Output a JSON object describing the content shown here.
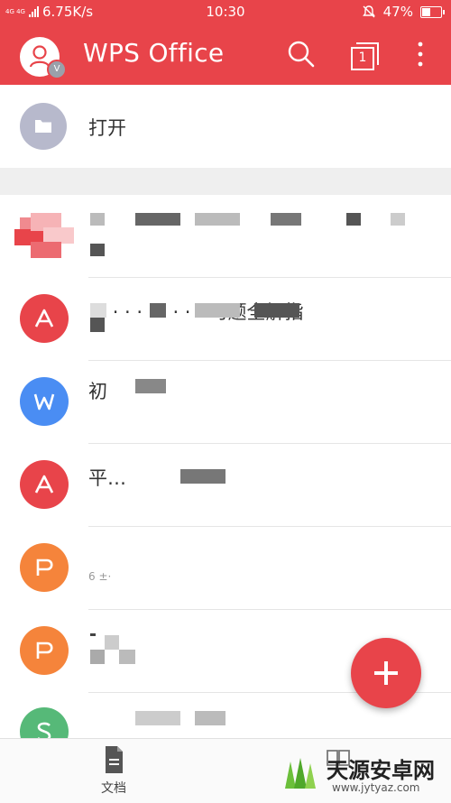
{
  "status_bar": {
    "network_badge": "4G 4G",
    "speed": "6.75K/s",
    "time": "10:30",
    "battery_percent": "47%",
    "battery_level": 0.47
  },
  "app_bar": {
    "title": "WPS Office",
    "avatar_badge": "V",
    "tab_count": "1"
  },
  "open_item": {
    "label": "打开"
  },
  "files": [
    {
      "icon": "pdf",
      "color": "#e8444a",
      "name": "",
      "sub": ""
    },
    {
      "icon": "pdf",
      "color": "#e8444a",
      "name": "·  ·  ·  ·   ·  ·  ·  ·   ·  ·  习题全解指",
      "sub": ""
    },
    {
      "icon": "writer",
      "color": "#4a8df3",
      "name": "初",
      "sub": ""
    },
    {
      "icon": "pdf",
      "color": "#e8444a",
      "name": "平…",
      "sub": ""
    },
    {
      "icon": "presentation",
      "color": "#f5843b",
      "name": "",
      "sub": "6 ±·"
    },
    {
      "icon": "presentation",
      "color": "#f5843b",
      "name": "",
      "sub": ""
    },
    {
      "icon": "spreadsheet",
      "color": "#56b978",
      "name": "",
      "sub": ""
    }
  ],
  "bottom_nav": {
    "docs_label": "文档"
  },
  "watermark": {
    "text": "天源安卓网",
    "url": "www.jytyaz.com"
  }
}
